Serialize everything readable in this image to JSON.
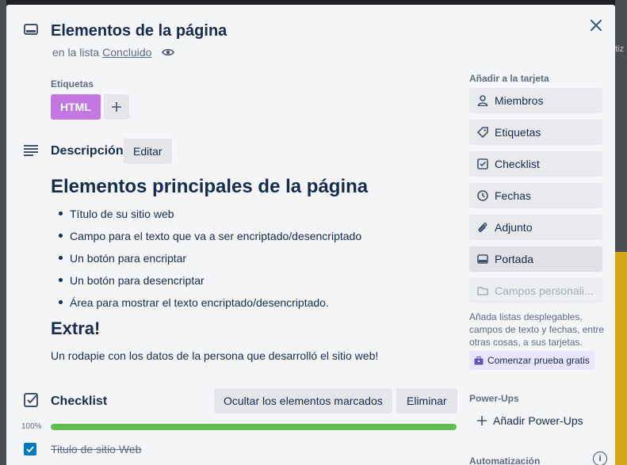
{
  "background": {
    "hint_text": "tiz"
  },
  "card": {
    "title": "Elementos de la página",
    "list_prefix": "en la lista",
    "list_name": "Concluido"
  },
  "labels": {
    "heading": "Etiquetas",
    "items": [
      {
        "name": "HTML",
        "color": "#c377e0"
      }
    ]
  },
  "description": {
    "heading": "Descripción",
    "edit_label": "Editar",
    "h1": "Elementos principales de la página",
    "bullets": [
      "Título de su sitio web",
      "Campo para el texto que va a ser encriptado/desencriptado",
      "Un botón para encriptar",
      "Un botón para desencriptar",
      "Área para mostrar el texto encriptado/desencriptado."
    ],
    "h2": "Extra!",
    "paragraph": "Un rodapie con los datos de la persona que desarrolló el sitio web!"
  },
  "checklist": {
    "heading": "Checklist",
    "hide_label": "Ocultar los elementos marcados",
    "delete_label": "Eliminar",
    "progress_text": "100%",
    "progress_fraction": 1.0,
    "items": [
      {
        "text": "Titulo de sitio Web",
        "checked": true
      }
    ]
  },
  "sidebar": {
    "add_heading": "Añadir a la tarjeta",
    "buttons": [
      {
        "label": "Miembros",
        "icon": "person-icon"
      },
      {
        "label": "Etiquetas",
        "icon": "tag-icon"
      },
      {
        "label": "Checklist",
        "icon": "checkbox-icon"
      },
      {
        "label": "Fechas",
        "icon": "clock-icon"
      },
      {
        "label": "Adjunto",
        "icon": "paperclip-icon"
      },
      {
        "label": "Portada",
        "icon": "card-cover-icon"
      },
      {
        "label": "Campos personali...",
        "icon": "custom-fields-icon"
      }
    ],
    "note": "Añada listas desplegables, campos de texto y fechas, entre otras cosas, a sus tarjetas.",
    "trial_label": "Comenzar prueba gratis",
    "powerups_heading": "Power-Ups",
    "add_powerups_label": "Añadir Power-Ups",
    "automation_heading": "Automatización"
  },
  "colors": {
    "progress": "#61bd4f",
    "checkbox": "#0079bf",
    "label_purple": "#c377e0",
    "trial_bg": "#eae6ff"
  }
}
